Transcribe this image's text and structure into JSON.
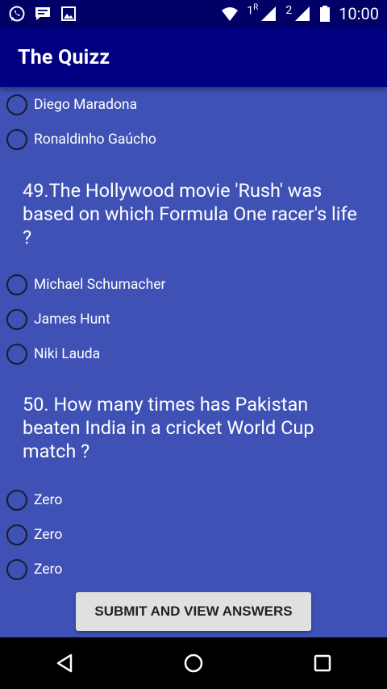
{
  "status_bar": {
    "icons": [
      "whatsapp-icon",
      "message-icon",
      "image-icon"
    ],
    "sim1_label": "1",
    "sim1_roaming": "R",
    "sim2_label": "2",
    "time": "10:00"
  },
  "app_bar": {
    "title": "The Quizz"
  },
  "quiz": {
    "prev_options": [
      "Diego Maradona",
      "Ronaldinho Gaúcho"
    ],
    "questions": [
      {
        "text": "49.The Hollywood movie 'Rush' was based on which Formula One racer's life ?",
        "options": [
          "Michael Schumacher",
          "James Hunt",
          "Niki Lauda"
        ]
      },
      {
        "text": "50. How many times has Pakistan beaten India in a cricket World Cup match ?",
        "options": [
          "Zero",
          "Zero",
          "Zero"
        ]
      }
    ]
  },
  "submit_label": "SUBMIT AND VIEW ANSWERS",
  "nav_bar": {
    "icons": [
      "back-icon",
      "home-icon",
      "recents-icon"
    ]
  },
  "colors": {
    "background": "#3f51b5",
    "app_bar": "#000080",
    "status_bar": "#000066"
  }
}
